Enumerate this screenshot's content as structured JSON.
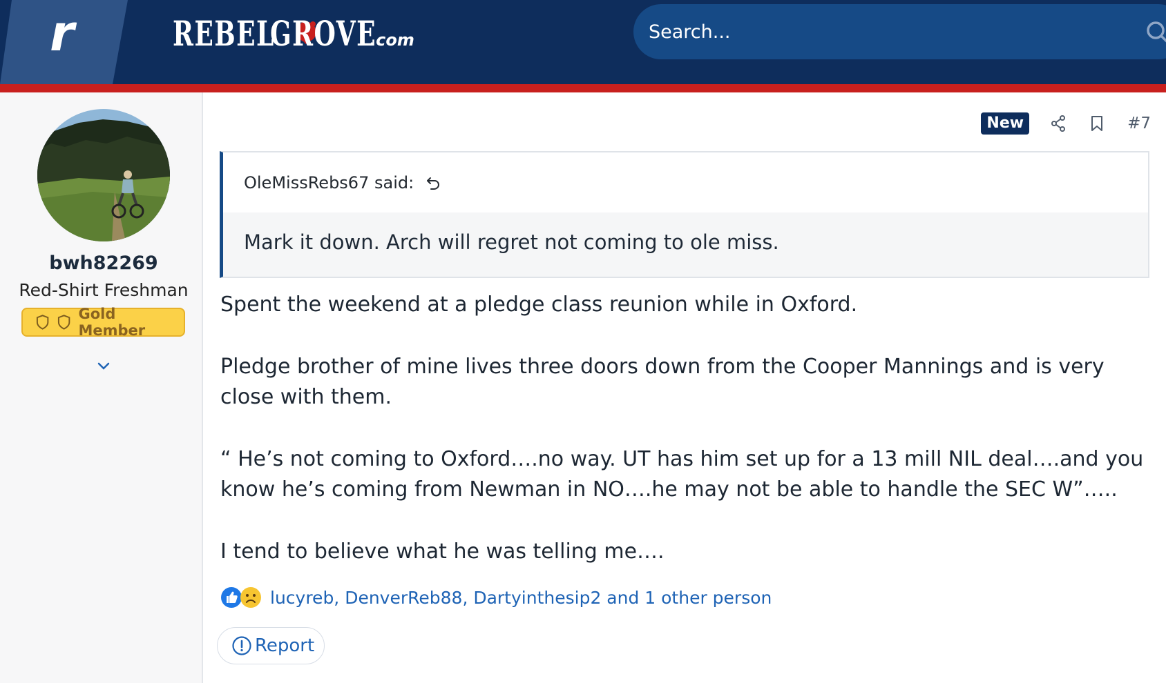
{
  "header": {
    "rivals_letter": "r",
    "site_logo": {
      "word1": "REBEL",
      "word2": "GROVE",
      "suffix": ".com"
    },
    "search_placeholder": "Search..."
  },
  "user": {
    "username": "bwh82269",
    "title": "Red-Shirt Freshman",
    "badge": "Gold Member",
    "avatar_icon": "avatar-mountain-biker-photo"
  },
  "post": {
    "new_label": "New",
    "post_number": "#7",
    "quote": {
      "author_line": "OleMissRebs67 said:",
      "text": "Mark it down. Arch will regret not coming to ole miss."
    },
    "paragraphs": [
      "Spent the weekend at a pledge class reunion while in Oxford.",
      "Pledge brother of mine lives three doors down from the Cooper Mannings and is very close with them.",
      "“ He’s not coming to Oxford….no way. UT has him set up for a 13 mill NIL deal….and you know he’s coming from Newman in NO….he may not be able to handle the SEC W”…..",
      "I tend to believe what he was telling me…."
    ],
    "reactions": {
      "icons": [
        "like-icon",
        "sad-icon"
      ],
      "names": "lucyreb, DenverReb88, Dartyinthesip2 and 1 other person"
    },
    "report_label": "Report"
  },
  "colors": {
    "header_bg": "#0e2d5c",
    "header_band": "#c8201e",
    "link": "#1e63b5",
    "badge_gold": "#fbd148",
    "quote_border": "#164a86"
  }
}
